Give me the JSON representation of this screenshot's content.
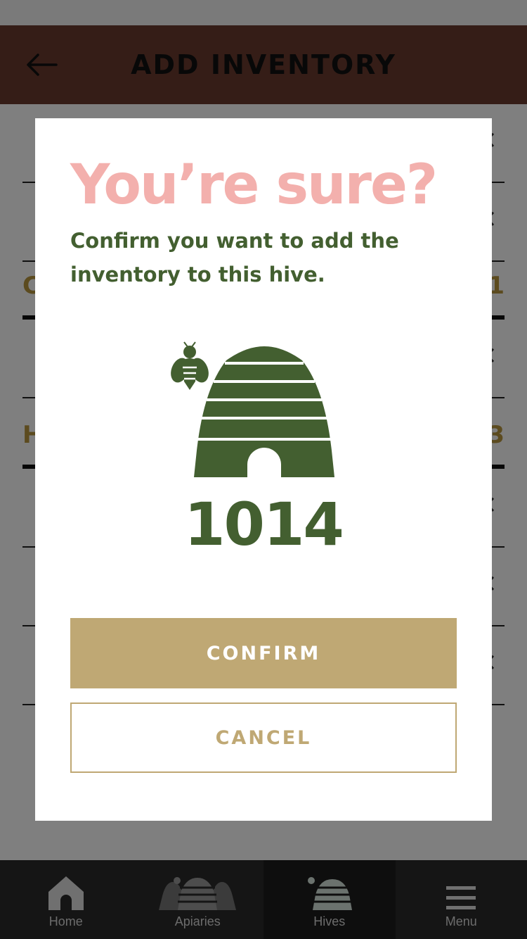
{
  "header": {
    "title": "ADD INVENTORY",
    "back_icon": "arrow-left-icon"
  },
  "background": {
    "sections": [
      {
        "label": "C",
        "count": "1"
      },
      {
        "label": "H",
        "count": "3"
      }
    ]
  },
  "modal": {
    "title": "You’re sure?",
    "subtitle": "Confirm you want to add the inventory to this hive.",
    "hive_number": "1014",
    "confirm_label": "CONFIRM",
    "cancel_label": "CANCEL",
    "colors": {
      "title": "#f3b0ad",
      "green": "#435f30",
      "gold": "#bfa874"
    }
  },
  "tabbar": {
    "tabs": [
      {
        "label": "Home",
        "icon": "home-icon"
      },
      {
        "label": "Apiaries",
        "icon": "apiaries-icon"
      },
      {
        "label": "Hives",
        "icon": "hive-icon",
        "active": true
      },
      {
        "label": "Menu",
        "icon": "menu-icon"
      }
    ]
  }
}
